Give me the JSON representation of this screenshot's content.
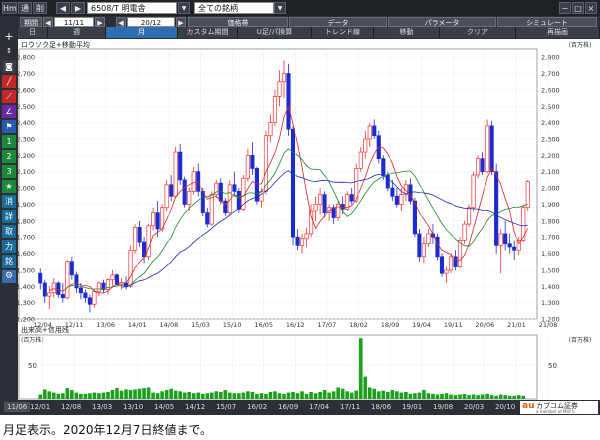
{
  "toolbar": {
    "menu_label": "Hm",
    "menu2_label": "通",
    "menu3_label": "削",
    "symbol": "6508/T 明電舎",
    "universe": "全ての銘柄"
  },
  "params": {
    "period_label": "期間",
    "start": "11/11",
    "end": "20/12",
    "price_change_label": "価格帯",
    "data_label": "データ",
    "parameter_label": "パラメータ",
    "simulate_label": "シミュレート"
  },
  "tabs": [
    {
      "label": "日"
    },
    {
      "label": "週"
    },
    {
      "label": "月"
    },
    {
      "label": "カスタム期間"
    },
    {
      "label": "U足/パ換算"
    },
    {
      "label": "トレンド線"
    },
    {
      "label": "移動"
    },
    {
      "label": "クリア"
    },
    {
      "label": "再描画"
    }
  ],
  "sidebar": {
    "items": [
      {
        "label": "1"
      },
      {
        "label": "2"
      },
      {
        "label": "3"
      },
      {
        "label": "★"
      },
      {
        "label": "消"
      },
      {
        "label": "詳"
      },
      {
        "label": "取"
      },
      {
        "label": "力"
      },
      {
        "label": "銘"
      }
    ]
  },
  "price_panel": {
    "title": "ロウソク足+移動平均",
    "unit": "(百万株)",
    "yticks": [
      "2,800",
      "2,700",
      "2,600",
      "2,500",
      "2,400",
      "2,300",
      "2,200",
      "2,100",
      "2,000",
      "1,900",
      "1,800",
      "1,700",
      "1,600",
      "1,500",
      "1,400",
      "1,300",
      "1,200"
    ],
    "xticks": [
      "12/04",
      "12/11",
      "13/06",
      "14/01",
      "14/08",
      "15/03",
      "15/10",
      "16/05",
      "16/12",
      "17/07",
      "18/02",
      "18/09",
      "19/04",
      "19/11",
      "20/06",
      "21/01",
      "21/08"
    ]
  },
  "volume_panel": {
    "title": "出来高+信用残",
    "unit": "(百万株)",
    "ytick": "50"
  },
  "bottombar": {
    "period_label": "11/06",
    "dates": [
      "12/01",
      "12/08",
      "13/03",
      "13/10",
      "14/05",
      "14/12",
      "15/07",
      "16/02",
      "16/09",
      "17/04",
      "17/11",
      "18/06",
      "19/01",
      "19/08",
      "20/03",
      "20/10"
    ],
    "brand_main": "カブコム証券",
    "brand_au": "au",
    "brand_sub": "a member of MUFG"
  },
  "caption": "月足表示。2020年12月7日終値まで。",
  "colors": {
    "up": "#e33",
    "down": "#1d2bd0",
    "ma_short": "#d22",
    "ma_mid": "#1a8a2a",
    "ma_long": "#1a2ab0",
    "volume": "#1aa01a"
  },
  "chart_data": {
    "type": "candlestick",
    "y_range": [
      1200,
      2850
    ],
    "volume_range": [
      0,
      100
    ],
    "start_month": "2011-11",
    "candles": [
      [
        1480,
        1510,
        1380,
        1420
      ],
      [
        1420,
        1440,
        1300,
        1340
      ],
      [
        1340,
        1400,
        1260,
        1360
      ],
      [
        1360,
        1450,
        1330,
        1420
      ],
      [
        1420,
        1430,
        1330,
        1350
      ],
      [
        1350,
        1420,
        1300,
        1330
      ],
      [
        1330,
        1560,
        1320,
        1550
      ],
      [
        1550,
        1580,
        1440,
        1470
      ],
      [
        1470,
        1490,
        1360,
        1390
      ],
      [
        1390,
        1420,
        1320,
        1360
      ],
      [
        1360,
        1380,
        1300,
        1330
      ],
      [
        1330,
        1350,
        1240,
        1290
      ],
      [
        1290,
        1380,
        1270,
        1370
      ],
      [
        1370,
        1430,
        1340,
        1420
      ],
      [
        1420,
        1440,
        1360,
        1380
      ],
      [
        1380,
        1450,
        1350,
        1440
      ],
      [
        1440,
        1500,
        1400,
        1470
      ],
      [
        1470,
        1480,
        1400,
        1410
      ],
      [
        1410,
        1450,
        1380,
        1420
      ],
      [
        1420,
        1460,
        1380,
        1400
      ],
      [
        1400,
        1650,
        1390,
        1620
      ],
      [
        1620,
        1780,
        1600,
        1760
      ],
      [
        1760,
        1800,
        1640,
        1670
      ],
      [
        1670,
        1700,
        1540,
        1580
      ],
      [
        1580,
        1780,
        1560,
        1770
      ],
      [
        1770,
        1880,
        1740,
        1850
      ],
      [
        1850,
        1920,
        1700,
        1750
      ],
      [
        1750,
        1900,
        1730,
        1880
      ],
      [
        1880,
        2050,
        1860,
        2020
      ],
      [
        2020,
        2080,
        1920,
        1950
      ],
      [
        1950,
        2250,
        1940,
        2220
      ],
      [
        2220,
        2270,
        2020,
        2050
      ],
      [
        2050,
        2070,
        1880,
        1900
      ],
      [
        1900,
        2000,
        1860,
        1980
      ],
      [
        1980,
        2130,
        1960,
        2100
      ],
      [
        2100,
        2150,
        1950,
        1980
      ],
      [
        1980,
        2000,
        1830,
        1850
      ],
      [
        1850,
        1880,
        1760,
        1780
      ],
      [
        1780,
        1980,
        1770,
        1960
      ],
      [
        1960,
        2050,
        1940,
        2030
      ],
      [
        2030,
        2060,
        1900,
        1920
      ],
      [
        1920,
        1940,
        1830,
        1850
      ],
      [
        1850,
        2050,
        1840,
        2020
      ],
      [
        2020,
        2100,
        1950,
        1980
      ],
      [
        1980,
        2000,
        1850,
        1870
      ],
      [
        1870,
        2080,
        1860,
        2060
      ],
      [
        2060,
        2240,
        2040,
        2200
      ],
      [
        2200,
        2280,
        2080,
        2120
      ],
      [
        2120,
        2130,
        1900,
        1920
      ],
      [
        1920,
        2000,
        1880,
        1980
      ],
      [
        1980,
        2350,
        1960,
        2320
      ],
      [
        2320,
        2450,
        2280,
        2400
      ],
      [
        2400,
        2600,
        2380,
        2560
      ],
      [
        2560,
        2720,
        2500,
        2650
      ],
      [
        2650,
        2780,
        2550,
        2700
      ],
      [
        2700,
        2760,
        2320,
        2360
      ],
      [
        2360,
        2380,
        1650,
        1700
      ],
      [
        1700,
        1750,
        1620,
        1650
      ],
      [
        1650,
        1720,
        1600,
        1690
      ],
      [
        1690,
        1760,
        1640,
        1720
      ],
      [
        1720,
        1900,
        1700,
        1860
      ],
      [
        1860,
        1950,
        1800,
        1900
      ],
      [
        1900,
        2000,
        1840,
        1960
      ],
      [
        1960,
        1980,
        1820,
        1850
      ],
      [
        1850,
        1900,
        1800,
        1880
      ],
      [
        1880,
        1900,
        1780,
        1820
      ],
      [
        1820,
        1920,
        1800,
        1900
      ],
      [
        1900,
        1950,
        1840,
        1870
      ],
      [
        1870,
        1980,
        1860,
        1960
      ],
      [
        1960,
        2000,
        1900,
        1920
      ],
      [
        1920,
        2150,
        1910,
        2120
      ],
      [
        2120,
        2250,
        2100,
        2220
      ],
      [
        2220,
        2350,
        2180,
        2300
      ],
      [
        2300,
        2400,
        2250,
        2380
      ],
      [
        2380,
        2420,
        2300,
        2320
      ],
      [
        2320,
        2350,
        2150,
        2180
      ],
      [
        2180,
        2200,
        2050,
        2080
      ],
      [
        2080,
        2100,
        1980,
        2000
      ],
      [
        2000,
        2050,
        1920,
        1950
      ],
      [
        1950,
        2000,
        1880,
        1900
      ],
      [
        1900,
        2000,
        1860,
        1960
      ],
      [
        1960,
        2050,
        1920,
        2020
      ],
      [
        2020,
        2060,
        1900,
        1920
      ],
      [
        1920,
        1940,
        1700,
        1720
      ],
      [
        1720,
        1750,
        1550,
        1580
      ],
      [
        1580,
        1700,
        1540,
        1660
      ],
      [
        1660,
        1750,
        1640,
        1720
      ],
      [
        1720,
        1780,
        1660,
        1700
      ],
      [
        1700,
        1720,
        1560,
        1580
      ],
      [
        1580,
        1600,
        1460,
        1480
      ],
      [
        1480,
        1520,
        1420,
        1500
      ],
      [
        1500,
        1600,
        1480,
        1580
      ],
      [
        1580,
        1620,
        1500,
        1520
      ],
      [
        1520,
        1700,
        1510,
        1680
      ],
      [
        1680,
        1800,
        1660,
        1780
      ],
      [
        1780,
        1900,
        1760,
        1880
      ],
      [
        1880,
        2100,
        1860,
        2080
      ],
      [
        2080,
        2200,
        2060,
        2180
      ],
      [
        2180,
        2220,
        2080,
        2100
      ],
      [
        2100,
        2420,
        2090,
        2380
      ],
      [
        2380,
        2410,
        2080,
        2100
      ],
      [
        2100,
        2150,
        1600,
        1650
      ],
      [
        1650,
        1750,
        1480,
        1720
      ],
      [
        1720,
        1800,
        1620,
        1660
      ],
      [
        1660,
        1720,
        1600,
        1640
      ],
      [
        1640,
        1680,
        1560,
        1620
      ],
      [
        1620,
        1700,
        1590,
        1680
      ],
      [
        1680,
        1900,
        1670,
        1880
      ],
      [
        1880,
        2050,
        1860,
        2040
      ]
    ],
    "volumes": [
      7,
      15,
      12,
      10,
      8,
      9,
      17,
      14,
      10,
      8,
      8,
      9,
      10,
      9,
      10,
      11,
      14,
      17,
      13,
      15,
      14,
      15,
      16,
      17,
      18,
      10,
      9,
      12,
      14,
      16,
      13,
      12,
      10,
      11,
      9,
      10,
      8,
      9,
      10,
      12,
      11,
      14,
      10,
      9,
      9,
      10,
      12,
      11,
      8,
      9,
      8,
      11,
      12,
      9,
      8,
      10,
      11,
      9,
      12,
      8,
      11,
      9,
      11,
      14,
      10,
      12,
      18,
      16,
      12,
      10,
      13,
      95,
      35,
      18,
      16,
      12,
      13,
      11,
      14,
      12,
      10,
      11,
      8,
      9,
      10,
      14,
      9,
      8,
      7,
      8,
      9,
      7,
      6,
      7,
      8,
      6,
      7,
      6,
      7,
      8,
      6,
      5,
      7,
      6,
      5,
      5,
      6,
      5
    ],
    "ma_short": [],
    "ma_mid": [],
    "ma_long": []
  }
}
